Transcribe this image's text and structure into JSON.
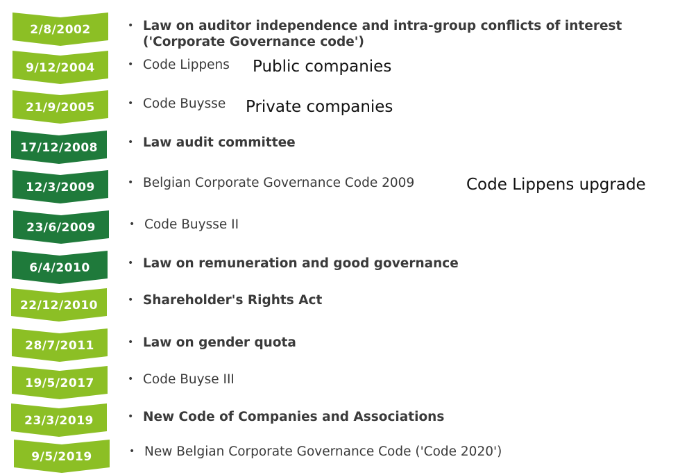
{
  "colors": {
    "light_green": "#8cbf25",
    "dark_green": "#1f7a3b",
    "text": "#3a3a3a"
  },
  "timeline": [
    {
      "date": "2/8/2002",
      "tone": "light",
      "bold": true,
      "text": "Law on auditor independence and intra-group conflicts of interest ('Corporate Governance code')"
    },
    {
      "date": "9/12/2004",
      "tone": "light",
      "bold": false,
      "text": "Code Lippens"
    },
    {
      "date": "21/9/2005",
      "tone": "light",
      "bold": false,
      "text": "Code Buysse"
    },
    {
      "date": "17/12/2008",
      "tone": "dark",
      "bold": true,
      "text": "Law audit committee"
    },
    {
      "date": "12/3/2009",
      "tone": "dark",
      "bold": false,
      "text": "Belgian Corporate Governance Code 2009"
    },
    {
      "date": "23/6/2009",
      "tone": "dark",
      "bold": false,
      "text": "Code Buysse II"
    },
    {
      "date": "6/4/2010",
      "tone": "dark",
      "bold": true,
      "text": "Law on remuneration and good governance"
    },
    {
      "date": "22/12/2010",
      "tone": "light",
      "bold": true,
      "text": "Shareholder's Rights Act"
    },
    {
      "date": "28/7/2011",
      "tone": "light",
      "bold": true,
      "text": "Law on gender quota"
    },
    {
      "date": "19/5/2017",
      "tone": "light",
      "bold": false,
      "text": "Code Buyse III"
    },
    {
      "date": "23/3/2019",
      "tone": "light",
      "bold": true,
      "text": "New Code of Companies and Associations"
    },
    {
      "date": "9/5/2019",
      "tone": "light",
      "bold": false,
      "text": "New Belgian Corporate Governance Code ('Code 2020')"
    }
  ],
  "bullet_char": "•",
  "annotations": {
    "public": "Public companies",
    "private": "Private companies",
    "upgrade": "Code Lippens upgrade"
  }
}
